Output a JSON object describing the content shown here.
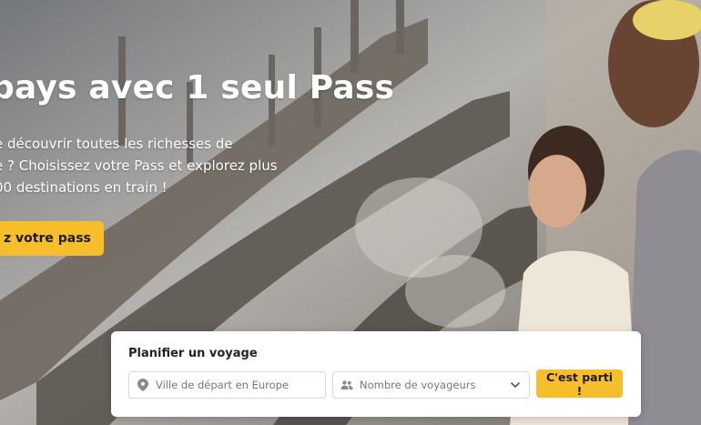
{
  "hero": {
    "headline": "pays avec 1 seul Pass",
    "subtitle_lines": [
      "e découvrir toutes les richesses de",
      "e ? Choisissez votre Pass et explorez plus",
      "00 destinations en train !"
    ],
    "cta_label": "z votre pass"
  },
  "planner": {
    "title": "Planifier un voyage",
    "origin_placeholder": "Ville de départ en Europe",
    "travelers_placeholder": "Nombre de voyageurs",
    "submit_label": "C'est parti !"
  },
  "icons": {
    "origin": "location-pin-icon",
    "travelers": "people-icon",
    "dropdown": "chevron-down-icon"
  },
  "colors": {
    "accent": "#f6be2a",
    "text_light": "#ffffff",
    "text_dark": "#222222"
  }
}
